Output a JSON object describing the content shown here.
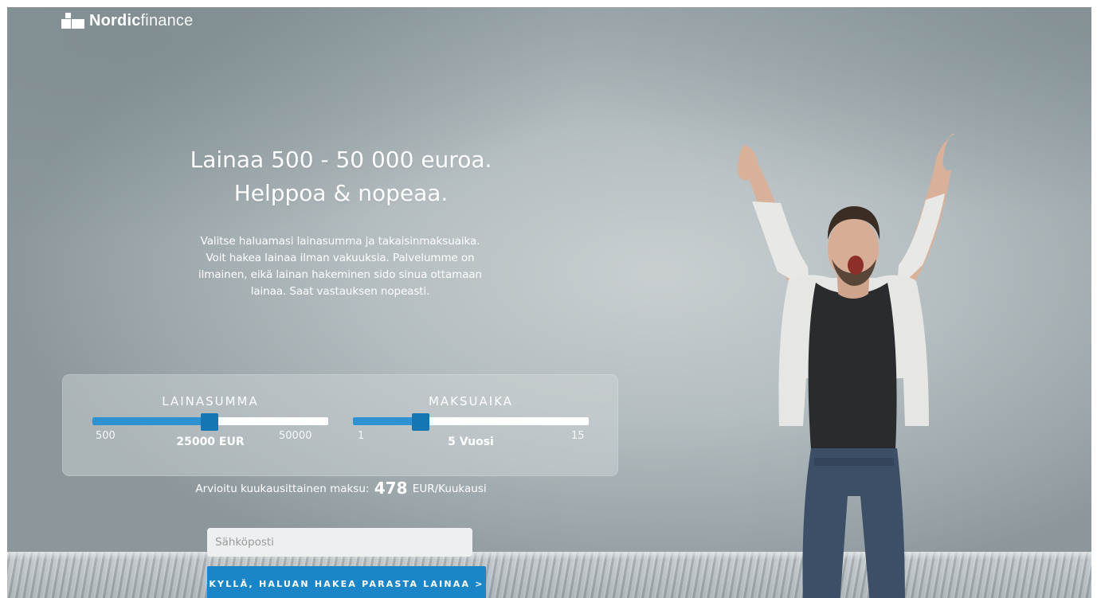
{
  "brand": {
    "name_bold": "Nordic",
    "name_light": "finance"
  },
  "hero": {
    "headline_line1": "Lainaa 500 - 50 000 euroa.",
    "headline_line2": "Helppoa & nopeaa.",
    "intro": "Valitse haluamasi lainasumma ja takaisinmaksuaika. Voit hakea lainaa ilman vakuuksia. Palvelumme on ilmainen, eikä lainan hakeminen sido sinua ottamaan lainaa. Saat vastauksen nopeasti."
  },
  "calculator": {
    "amount": {
      "title": "LAINASUMMA",
      "min": "500",
      "max": "50000",
      "value_label": "25000 EUR",
      "value": 25000,
      "min_value": 500,
      "max_value": 50000
    },
    "term": {
      "title": "MAKSUAIKA",
      "min": "1",
      "max": "15",
      "value_label": "5 Vuosi",
      "value": 5,
      "min_value": 1,
      "max_value": 15
    },
    "monthly_prefix": "Arvioitu kuukausittainen maksu:",
    "monthly_amount": "478",
    "monthly_suffix": "EUR/Kuukausi"
  },
  "form": {
    "email_placeholder": "Sähköposti",
    "cta_label": "KYLLÄ, HALUAN HAKEA PARASTA LAINAA >"
  },
  "colors": {
    "accent": "#1a86c7",
    "slider_fill": "#2d91d2",
    "slider_thumb": "#1676b3"
  }
}
